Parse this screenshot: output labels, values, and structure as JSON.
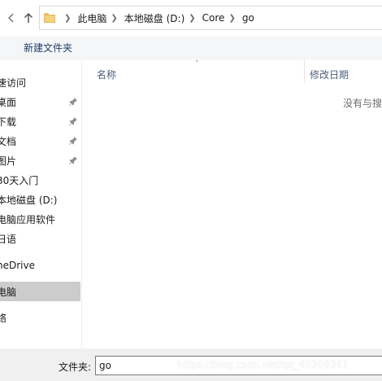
{
  "address_bar": {
    "breadcrumbs": [
      "此电脑",
      "本地磁盘 (D:)",
      "Core",
      "go"
    ]
  },
  "toolbar": {
    "new_folder_label": "新建文件夹"
  },
  "nav_pane": {
    "items": [
      {
        "label": "速访问",
        "pinned": false
      },
      {
        "label": "桌面",
        "pinned": true
      },
      {
        "label": "下载",
        "pinned": true
      },
      {
        "label": "文档",
        "pinned": true
      },
      {
        "label": "图片",
        "pinned": true
      },
      {
        "label": "30天入门",
        "pinned": false
      },
      {
        "label": "本地磁盘 (D:)",
        "pinned": false
      },
      {
        "label": "电脑应用软件",
        "pinned": false
      },
      {
        "label": "日语",
        "pinned": false
      },
      {
        "label": "neDrive",
        "pinned": false
      },
      {
        "label": "电脑",
        "pinned": false,
        "selected": true
      },
      {
        "label": "络",
        "pinned": false
      }
    ]
  },
  "file_list": {
    "columns": [
      "名称",
      "修改日期"
    ],
    "empty_message": "没有与搜"
  },
  "bottom_bar": {
    "filename_label": "文件夹:",
    "filename_value": "go",
    "watermark": "https://blog.csdn.net/qq_40309341"
  },
  "colors": {
    "selected_bg": "#cccccc",
    "toolbar_bg": "#f5f6f7",
    "bottom_bg": "#f0f0f0",
    "folder_yellow": "#f5d27a",
    "column_header_text": "#4c607a"
  }
}
